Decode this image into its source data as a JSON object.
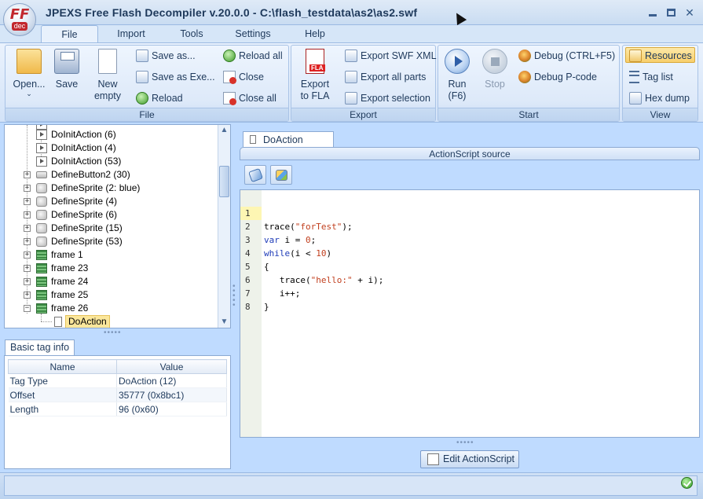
{
  "window": {
    "title": "JPEXS Free Flash Decompiler v.20.0.0 - C:\\flash_testdata\\as2\\as2.swf",
    "logo": {
      "main": "FF",
      "sub": "dec"
    }
  },
  "menu": {
    "tabs": [
      {
        "label": "File",
        "active": true
      },
      {
        "label": "Import"
      },
      {
        "label": "Tools"
      },
      {
        "label": "Settings"
      },
      {
        "label": "Help"
      }
    ]
  },
  "ribbon": {
    "file_group": {
      "label": "File",
      "open": "Open...",
      "save": "Save",
      "new_empty_1": "New",
      "new_empty_2": "empty",
      "save_as": "Save as...",
      "save_as_exe": "Save as Exe...",
      "reload": "Reload",
      "reload_all": "Reload all",
      "close": "Close",
      "close_all": "Close all"
    },
    "export_group": {
      "label": "Export",
      "export_fla_1": "Export",
      "export_fla_2": "to FLA",
      "export_swf_xml": "Export SWF XML",
      "export_all_parts": "Export all parts",
      "export_selection": "Export selection"
    },
    "start_group": {
      "label": "Start",
      "run_1": "Run",
      "run_2": "(F6)",
      "stop": "Stop",
      "debug": "Debug (CTRL+F5)",
      "debug_pcode": "Debug P-code"
    },
    "view_group": {
      "label": "View",
      "resources": "Resources",
      "tag_list": "Tag list",
      "hex_dump": "Hex dump"
    }
  },
  "tree": {
    "items": [
      {
        "label": "DoInitAction (6)"
      },
      {
        "label": "DoInitAction (4)"
      },
      {
        "label": "DoInitAction (53)"
      },
      {
        "label": "DefineButton2 (30)"
      },
      {
        "label": "DefineSprite (2: blue)"
      },
      {
        "label": "DefineSprite (4)"
      },
      {
        "label": "DefineSprite (6)"
      },
      {
        "label": "DefineSprite (15)"
      },
      {
        "label": "DefineSprite (53)"
      },
      {
        "label": "frame 1"
      },
      {
        "label": "frame 23"
      },
      {
        "label": "frame 24"
      },
      {
        "label": "frame 25"
      },
      {
        "label": "frame 26"
      },
      {
        "label": "DoAction"
      }
    ]
  },
  "tag_info": {
    "tab_label": "Basic tag info",
    "headers": {
      "name": "Name",
      "value": "Value"
    },
    "rows": [
      {
        "name": "Tag Type",
        "value": "DoAction (12)"
      },
      {
        "name": "Offset",
        "value": "35777 (0x8bc1)"
      },
      {
        "name": "Length",
        "value": "96 (0x60)"
      }
    ]
  },
  "editor": {
    "tab_label": "DoAction",
    "header": "ActionScript source",
    "edit_button": "Edit ActionScript",
    "line_numbers": [
      "1",
      "2",
      "3",
      "4",
      "5",
      "6",
      "7",
      "8"
    ],
    "current_line": 1
  },
  "colors": {
    "accent": "#1e395b",
    "selection": "#fbe79b",
    "keyword": "#1f3cb8",
    "string": "#c13f1e"
  }
}
